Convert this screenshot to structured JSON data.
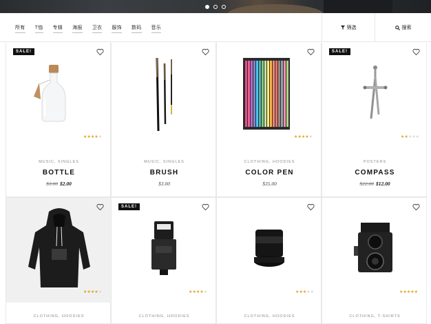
{
  "hero": {
    "slides": 3,
    "active_slide": 1
  },
  "filter": {
    "categories": [
      "所有",
      "T恤",
      "专辑",
      "海报",
      "卫衣",
      "服饰",
      "数码",
      "音乐"
    ],
    "filter_label": "筛选",
    "search_label": "搜索"
  },
  "products": [
    {
      "name": "BOTTLE",
      "category": "MUSIC, SINGLES",
      "old_price": "$3.00",
      "price": "$2.00",
      "sale": true,
      "sale_label": "SALE!",
      "rating": 4
    },
    {
      "name": "BRUSH",
      "category": "MUSIC, SINGLES",
      "old_price": "",
      "price": "$3.00",
      "sale": false,
      "rating": 0
    },
    {
      "name": "COLOR PEN",
      "category": "CLOTHING, HOODIES",
      "old_price": "",
      "price": "$35.00",
      "sale": false,
      "rating": 4
    },
    {
      "name": "COMPASS",
      "category": "POSTERS",
      "old_price": "$22.00",
      "price": "$12.00",
      "sale": true,
      "sale_label": "SALE!",
      "rating": 2
    },
    {
      "name": "",
      "category": "CLOTHING, HOODIES",
      "old_price": "",
      "price": "",
      "sale": false,
      "rating": 4
    },
    {
      "name": "",
      "category": "CLOTHING, HOODIES",
      "old_price": "",
      "price": "",
      "sale": true,
      "sale_label": "SALE!",
      "rating": 4
    },
    {
      "name": "",
      "category": "CLOTHING, HOODIES",
      "old_price": "",
      "price": "",
      "sale": false,
      "rating": 3
    },
    {
      "name": "",
      "category": "CLOTHING, T-SHIRTS",
      "old_price": "",
      "price": "",
      "sale": false,
      "rating": 5
    }
  ],
  "colors": {
    "star": "#e0a31a",
    "sale_bg": "#111111",
    "border": "#e8e8e8"
  }
}
